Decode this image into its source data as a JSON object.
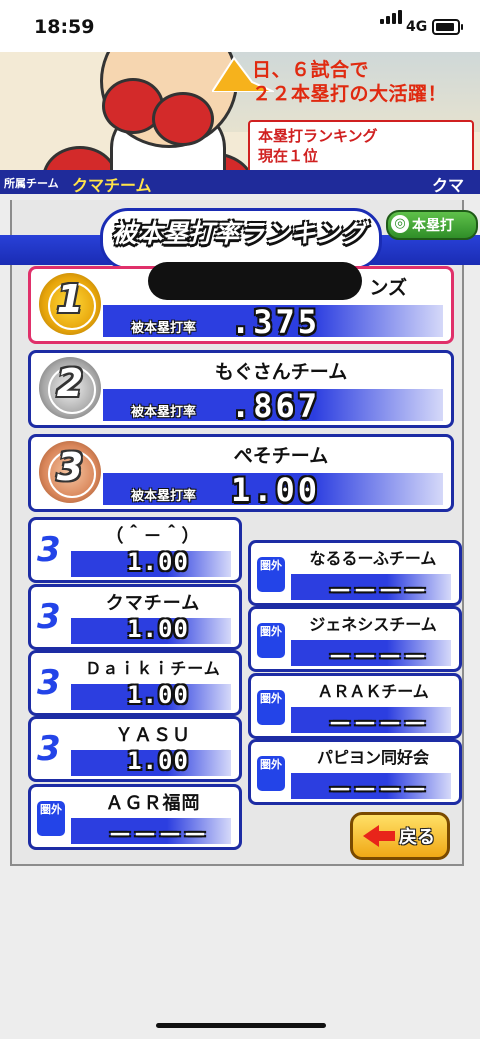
{
  "status_bar": {
    "time": "18:59",
    "network": "4G"
  },
  "banner": {
    "headline": "日、６試合で\n２２本塁打の大活躍！",
    "ranking_box": "本塁打ランキング\n現在１位",
    "team_label": "所属チーム",
    "team_name": "クマチーム",
    "user_name": "クマ"
  },
  "header": {
    "title": "被本塁打率ランキング",
    "toggle_label": "本塁打",
    "toggle_icon": "◎"
  },
  "top_ranks": [
    {
      "rank": "1",
      "team": "ンズ",
      "label": "被本塁打率",
      "value": ".375"
    },
    {
      "rank": "2",
      "team": "もぐさんチーム",
      "label": "被本塁打率",
      "value": ".867"
    },
    {
      "rank": "3",
      "team": "ぺそチーム",
      "label": "被本塁打率",
      "value": "1.00"
    }
  ],
  "left_list": [
    {
      "rank": "3",
      "team": "（＾－＾）",
      "value": "1.00"
    },
    {
      "rank": "3",
      "team": "クマチーム",
      "value": "1.00"
    },
    {
      "rank": "3",
      "team": "Ｄａｉｋｉチーム",
      "value": "1.00"
    },
    {
      "rank": "3",
      "team": "ＹＡＳＵ",
      "value": "1.00"
    },
    {
      "rank": "圏外",
      "team": "ＡＧＲ福岡",
      "value": "－－－－"
    }
  ],
  "right_list": [
    {
      "rank": "圏外",
      "team": "なるるーふチーム",
      "value": "－－－－"
    },
    {
      "rank": "圏外",
      "team": "ジェネシスチーム",
      "value": "－－－－"
    },
    {
      "rank": "圏外",
      "team": "ＡＲＡＫチーム",
      "value": "－－－－"
    },
    {
      "rank": "圏外",
      "team": "パピヨン同好会",
      "value": "－－－－"
    }
  ],
  "back_button": "戻る"
}
